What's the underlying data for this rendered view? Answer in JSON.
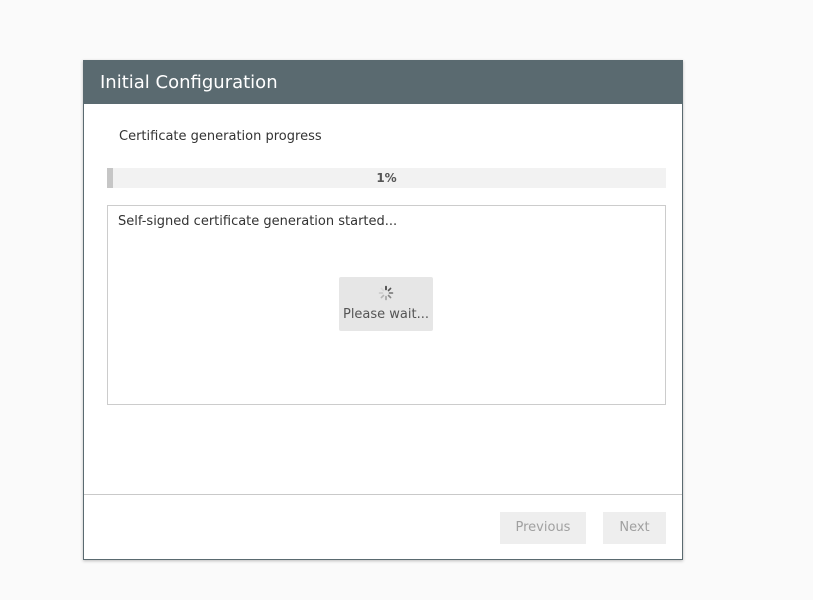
{
  "dialog": {
    "title": "Initial Configuration",
    "progress_label": "Certificate generation progress",
    "progress": {
      "percent": 1,
      "text": "1%"
    },
    "log_text": "Self-signed certificate generation started...",
    "wait_text": "Please wait...",
    "buttons": {
      "previous": "Previous",
      "next": "Next"
    }
  },
  "colors": {
    "header_bg": "#5a6a70",
    "progress_fill": "#c6c6c6",
    "button_bg": "#eeeeee",
    "button_text_disabled": "#a0a0a0"
  }
}
